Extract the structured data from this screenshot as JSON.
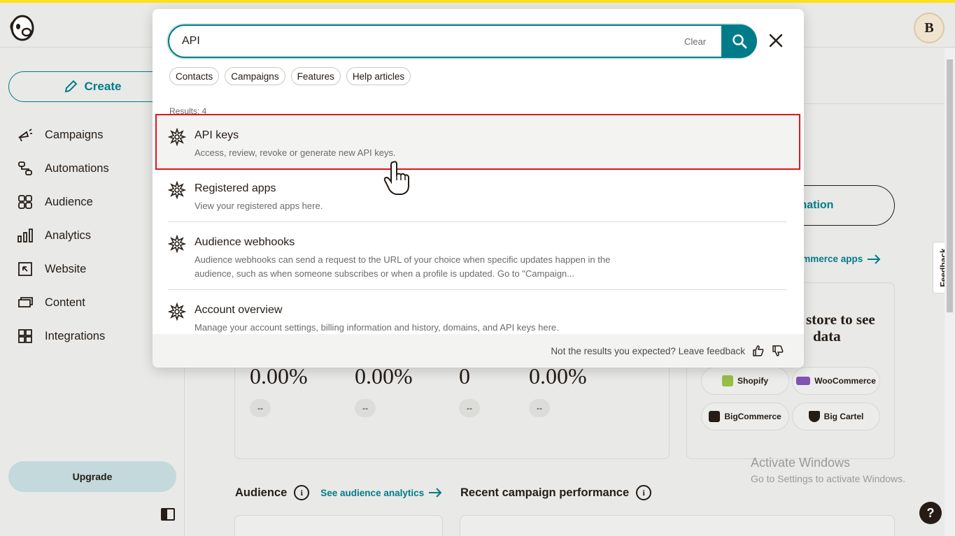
{
  "header": {
    "avatar_initial": "B"
  },
  "sidebar": {
    "create_label": "Create",
    "items": [
      {
        "label": "Campaigns",
        "icon": "campaigns-icon"
      },
      {
        "label": "Automations",
        "icon": "automations-icon"
      },
      {
        "label": "Audience",
        "icon": "audience-icon"
      },
      {
        "label": "Analytics",
        "icon": "analytics-icon"
      },
      {
        "label": "Website",
        "icon": "website-icon"
      },
      {
        "label": "Content",
        "icon": "content-icon"
      },
      {
        "label": "Integrations",
        "icon": "integrations-icon"
      }
    ],
    "upgrade_label": "Upgrade"
  },
  "search": {
    "query": "API",
    "clear_label": "Clear",
    "filters": [
      "Contacts",
      "Campaigns",
      "Features",
      "Help articles"
    ],
    "results_count": "Results: 4",
    "results": [
      {
        "title": "API keys",
        "desc": "Access, review, revoke or generate new API keys."
      },
      {
        "title": "Registered apps",
        "desc": "View your registered apps here."
      },
      {
        "title": "Audience webhooks",
        "desc": "Audience webhooks can send a request to the URL of your choice when specific updates happen in the audience, such as when someone subscribes or when a profile is updated. Go to \"Campaign..."
      },
      {
        "title": "Account overview",
        "desc": "Manage your account settings, billing information and history, domains, and API keys here."
      }
    ],
    "footer_text": "Not the results you expected? Leave feedback"
  },
  "main": {
    "automation_label": "mation",
    "commerce_link": "ommerce apps",
    "stats": [
      {
        "value": "0.00%",
        "chip": "--"
      },
      {
        "value": "0.00%",
        "chip": "--"
      },
      {
        "value": "0",
        "chip": "--"
      },
      {
        "value": "0.00%",
        "chip": "--"
      }
    ],
    "store_title_line1": "store to see",
    "store_title_line2": "data",
    "stores": [
      "Shopify",
      "WooCommerce",
      "BigCommerce",
      "Big Cartel"
    ],
    "audience_title": "Audience",
    "audience_link": "See audience analytics",
    "recent_title": "Recent campaign performance"
  },
  "feedback_tab": "Feedback",
  "watermark": {
    "line1": "Activate Windows",
    "line2": "Go to Settings to activate Windows."
  },
  "colors": {
    "accent": "#007c89",
    "highlight": "#e2151b",
    "brand_yellow": "#ffe01b"
  }
}
